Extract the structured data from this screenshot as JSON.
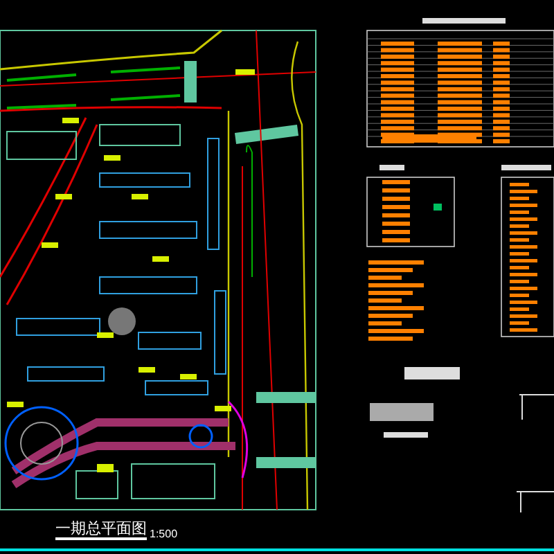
{
  "drawing": {
    "title": "一期总平面图",
    "scale": "1:500"
  }
}
